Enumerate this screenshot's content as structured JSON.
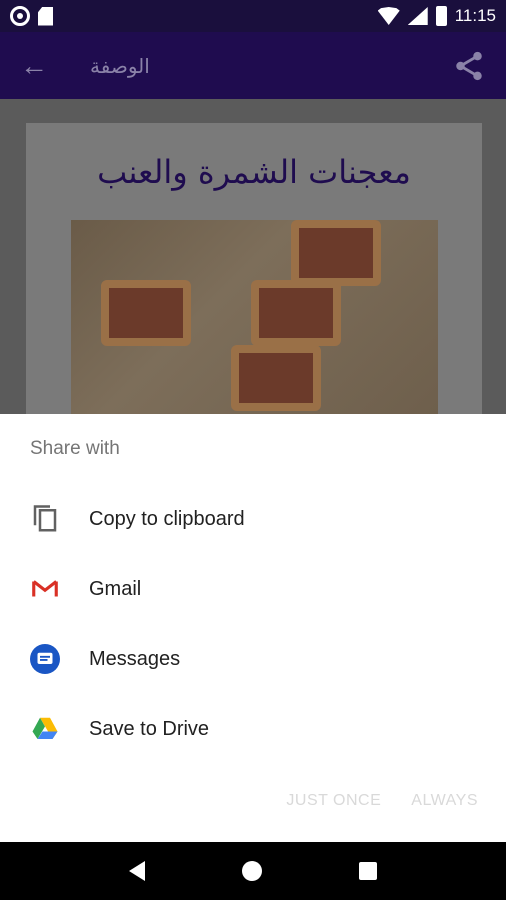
{
  "status_bar": {
    "time": "11:15",
    "icons": [
      "notification-dot-icon",
      "sd-card-icon",
      "wifi-icon",
      "signal-icon",
      "battery-icon"
    ]
  },
  "app_bar": {
    "title": "الوصفة",
    "back_icon": "arrow-left-icon",
    "share_icon": "share-icon",
    "bg_color": "#1f0c4f"
  },
  "recipe": {
    "title": "معجنات الشمرة والعنب"
  },
  "share_sheet": {
    "title": "Share with",
    "items": [
      {
        "label": "Copy to clipboard",
        "icon": "copy-icon"
      },
      {
        "label": "Gmail",
        "icon": "gmail-icon"
      },
      {
        "label": "Messages",
        "icon": "messages-icon"
      },
      {
        "label": "Save to Drive",
        "icon": "drive-icon"
      }
    ],
    "actions": {
      "just_once": "JUST ONCE",
      "always": "ALWAYS"
    }
  },
  "nav_bar": {
    "icons": [
      "nav-back-icon",
      "nav-home-icon",
      "nav-recents-icon"
    ]
  }
}
